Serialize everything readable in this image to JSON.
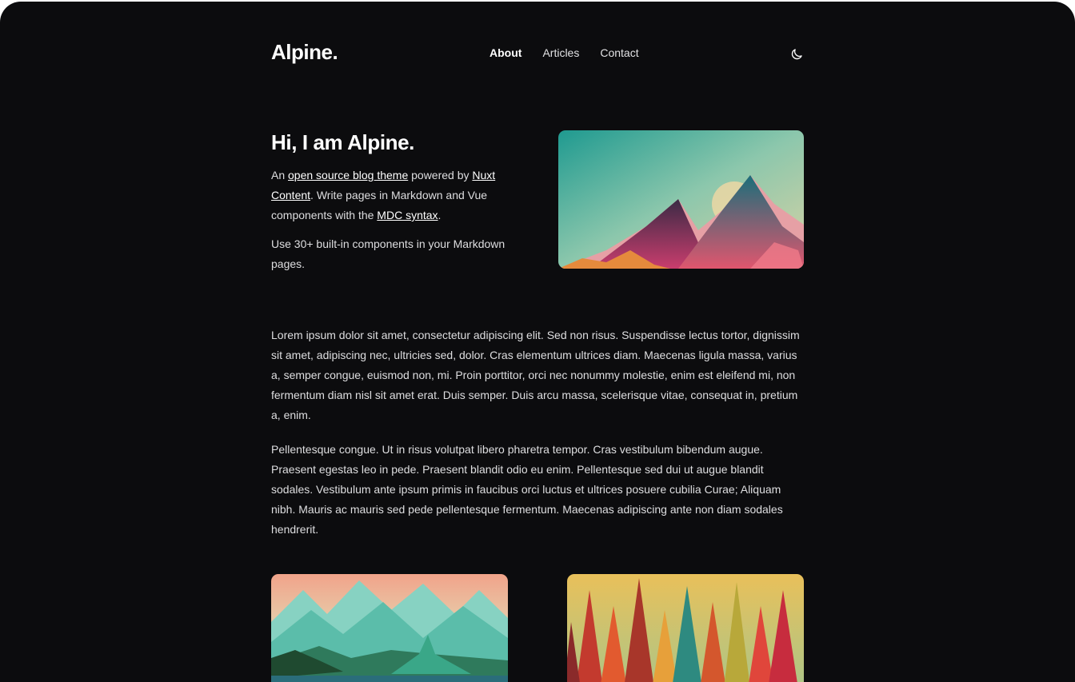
{
  "header": {
    "logo": "Alpine.",
    "nav": [
      {
        "label": "About",
        "active": true
      },
      {
        "label": "Articles",
        "active": false
      },
      {
        "label": "Contact",
        "active": false
      }
    ],
    "theme_icon": "moon-icon"
  },
  "hero": {
    "title": "Hi, I am Alpine.",
    "p1_prefix": "An ",
    "p1_link1": "open source blog theme",
    "p1_mid1": " powered by ",
    "p1_link2": "Nuxt Content",
    "p1_mid2": ". Write pages in Markdown and Vue components with the ",
    "p1_link3": "MDC syntax",
    "p1_suffix": ".",
    "p2": "Use 30+ built-in components in your Markdown pages."
  },
  "body": {
    "paragraphs": [
      "Lorem ipsum dolor sit amet, consectetur adipiscing elit. Sed non risus. Suspendisse lectus tortor, dignissim sit amet, adipiscing nec, ultricies sed, dolor. Cras elementum ultrices diam. Maecenas ligula massa, varius a, semper congue, euismod non, mi. Proin porttitor, orci nec nonummy molestie, enim est eleifend mi, non fermentum diam nisl sit amet erat. Duis semper. Duis arcu massa, scelerisque vitae, consequat in, pretium a, enim.",
      "Pellentesque congue. Ut in risus volutpat libero pharetra tempor. Cras vestibulum bibendum augue. Praesent egestas leo in pede. Praesent blandit odio eu enim. Pellentesque sed dui ut augue blandit sodales. Vestibulum ante ipsum primis in faucibus orci luctus et ultrices posuere cubilia Curae; Aliquam nibh. Mauris ac mauris sed pede pellentesque fermentum. Maecenas adipiscing ante non diam sodales hendrerit."
    ]
  },
  "colors": {
    "background": "#0c0c0e",
    "text": "#dedee0",
    "heading": "#ffffff"
  }
}
